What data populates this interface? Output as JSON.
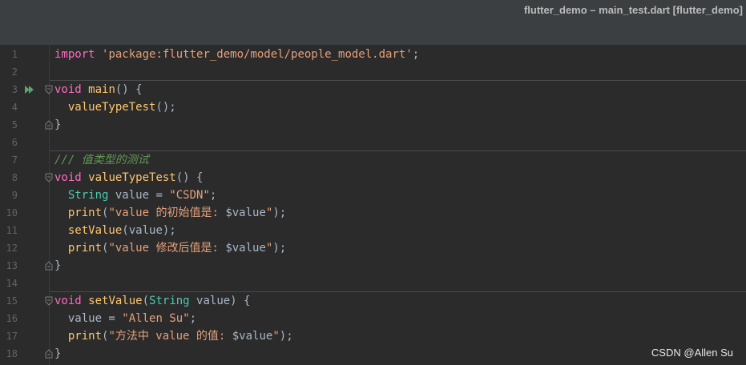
{
  "window": {
    "title": "flutter_demo – main_test.dart [flutter_demo]"
  },
  "editor": {
    "lines": [
      {
        "n": "1",
        "tokens": [
          {
            "t": "import",
            "c": "kw2"
          },
          {
            "t": " ",
            "c": "plain"
          },
          {
            "t": "'package:flutter_demo/model/people_model.dart'",
            "c": "str2"
          },
          {
            "t": ";",
            "c": "plain"
          }
        ]
      },
      {
        "n": "2",
        "tokens": []
      },
      {
        "n": "3",
        "tokens": [
          {
            "t": "void",
            "c": "kw2"
          },
          {
            "t": " ",
            "c": "plain"
          },
          {
            "t": "main",
            "c": "fn"
          },
          {
            "t": "() {",
            "c": "plain"
          }
        ]
      },
      {
        "n": "4",
        "tokens": [
          {
            "t": "  ",
            "c": "plain"
          },
          {
            "t": "valueTypeTest",
            "c": "fn"
          },
          {
            "t": "();",
            "c": "plain"
          }
        ]
      },
      {
        "n": "5",
        "tokens": [
          {
            "t": "}",
            "c": "plain"
          }
        ]
      },
      {
        "n": "6",
        "tokens": []
      },
      {
        "n": "7",
        "tokens": [
          {
            "t": "/// 值类型的测试",
            "c": "cmt"
          }
        ]
      },
      {
        "n": "8",
        "tokens": [
          {
            "t": "void",
            "c": "kw2"
          },
          {
            "t": " ",
            "c": "plain"
          },
          {
            "t": "valueTypeTest",
            "c": "fn"
          },
          {
            "t": "() {",
            "c": "plain"
          }
        ]
      },
      {
        "n": "9",
        "tokens": [
          {
            "t": "  ",
            "c": "plain"
          },
          {
            "t": "String",
            "c": "type"
          },
          {
            "t": " value = ",
            "c": "plain"
          },
          {
            "t": "\"CSDN\"",
            "c": "str2"
          },
          {
            "t": ";",
            "c": "plain"
          }
        ]
      },
      {
        "n": "10",
        "tokens": [
          {
            "t": "  ",
            "c": "plain"
          },
          {
            "t": "print",
            "c": "fn"
          },
          {
            "t": "(",
            "c": "plain"
          },
          {
            "t": "\"value 的初始值是: ",
            "c": "str2"
          },
          {
            "t": "$value",
            "c": "plain"
          },
          {
            "t": "\"",
            "c": "str2"
          },
          {
            "t": ");",
            "c": "plain"
          }
        ]
      },
      {
        "n": "11",
        "tokens": [
          {
            "t": "  ",
            "c": "plain"
          },
          {
            "t": "setValue",
            "c": "fn"
          },
          {
            "t": "(value);",
            "c": "plain"
          }
        ]
      },
      {
        "n": "12",
        "tokens": [
          {
            "t": "  ",
            "c": "plain"
          },
          {
            "t": "print",
            "c": "fn"
          },
          {
            "t": "(",
            "c": "plain"
          },
          {
            "t": "\"value 修改后值是: ",
            "c": "str2"
          },
          {
            "t": "$value",
            "c": "plain"
          },
          {
            "t": "\"",
            "c": "str2"
          },
          {
            "t": ");",
            "c": "plain"
          }
        ]
      },
      {
        "n": "13",
        "tokens": [
          {
            "t": "}",
            "c": "plain"
          }
        ]
      },
      {
        "n": "14",
        "tokens": []
      },
      {
        "n": "15",
        "tokens": [
          {
            "t": "void",
            "c": "kw2"
          },
          {
            "t": " ",
            "c": "plain"
          },
          {
            "t": "setValue",
            "c": "fn"
          },
          {
            "t": "(",
            "c": "plain"
          },
          {
            "t": "String",
            "c": "type"
          },
          {
            "t": " value) {",
            "c": "plain"
          }
        ]
      },
      {
        "n": "16",
        "tokens": [
          {
            "t": "  value = ",
            "c": "plain"
          },
          {
            "t": "\"Allen Su\"",
            "c": "str2"
          },
          {
            "t": ";",
            "c": "plain"
          }
        ]
      },
      {
        "n": "17",
        "tokens": [
          {
            "t": "  ",
            "c": "plain"
          },
          {
            "t": "print",
            "c": "fn"
          },
          {
            "t": "(",
            "c": "plain"
          },
          {
            "t": "\"方法中 value 的值: ",
            "c": "str2"
          },
          {
            "t": "$value",
            "c": "plain"
          },
          {
            "t": "\"",
            "c": "str2"
          },
          {
            "t": ");",
            "c": "plain"
          }
        ]
      },
      {
        "n": "18",
        "tokens": [
          {
            "t": "}",
            "c": "plain"
          }
        ]
      }
    ],
    "run_icon_line": "3",
    "fold_open_lines": [
      "3",
      "8",
      "15"
    ],
    "fold_close_lines": [
      "5",
      "13",
      "18"
    ],
    "separator_before_lines": [
      "3",
      "7",
      "15"
    ]
  },
  "watermark": "CSDN @Allen Su",
  "colors": {
    "background": "#2b2b2b",
    "keyword": "#ff6ac1",
    "function": "#ffc66d",
    "type": "#4ec9b0",
    "string": "#e6a07a",
    "comment": "#629755",
    "run_icon": "#59a869"
  }
}
